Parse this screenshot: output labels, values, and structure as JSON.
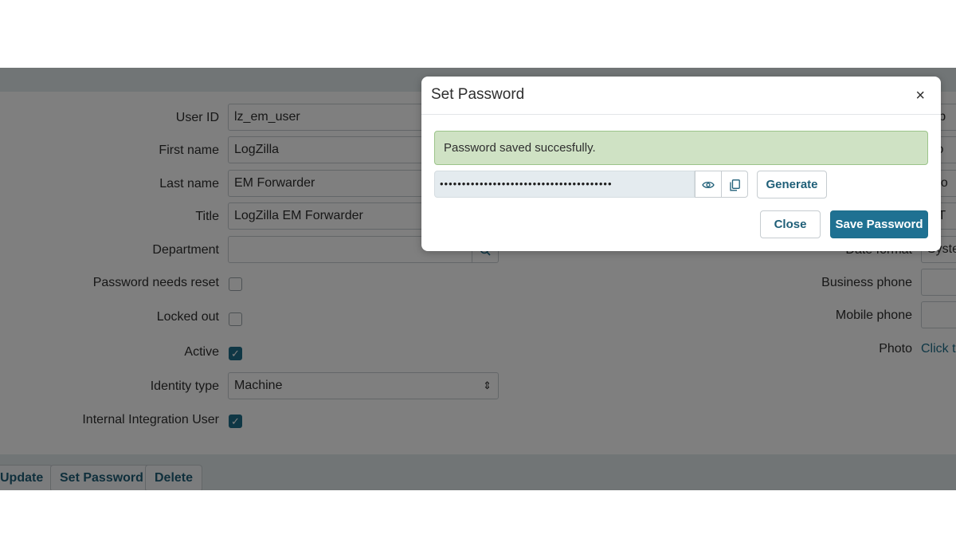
{
  "form": {
    "left_fields": [
      {
        "label": "User ID",
        "value": "lz_em_user"
      },
      {
        "label": "First name",
        "value": "LogZilla"
      },
      {
        "label": "Last name",
        "value": "EM Forwarder"
      },
      {
        "label": "Title",
        "value": "LogZilla EM Forwarder"
      },
      {
        "label": "Department",
        "value": ""
      }
    ],
    "checkboxes": [
      {
        "label": "Password needs reset",
        "checked": false
      },
      {
        "label": "Locked out",
        "checked": false
      },
      {
        "label": "Active",
        "checked": true
      }
    ],
    "identity_type": {
      "label": "Identity type",
      "value": "Machine"
    },
    "internal_integration": {
      "label": "Internal Integration User",
      "checked": true
    },
    "right_fields": [
      {
        "label": "",
        "value": "rep"
      },
      {
        "label": "",
        "value": "No"
      },
      {
        "label": "",
        "value": "utlo"
      },
      {
        "label": "",
        "value": "MT"
      },
      {
        "label": "Date format",
        "value": "Syste"
      },
      {
        "label": "Business phone",
        "value": ""
      },
      {
        "label": "Mobile phone",
        "value": ""
      }
    ],
    "photo": {
      "label": "Photo",
      "link": "Click to"
    }
  },
  "actions": {
    "update": "Update",
    "set_password": "Set Password",
    "delete": "Delete"
  },
  "modal": {
    "title": "Set Password",
    "close_icon": "×",
    "alert": "Password saved succesfully.",
    "password_mask": "•••••••••••••••••••••••••••••••••••••••",
    "show_icon": "eye-icon",
    "copy_icon": "copy-icon",
    "generate": "Generate",
    "close": "Close",
    "save": "Save Password"
  },
  "colors": {
    "accent": "#1f7192",
    "alert_bg": "#cfe2c4",
    "overlay": "rgba(0,0,0,0.5)"
  }
}
